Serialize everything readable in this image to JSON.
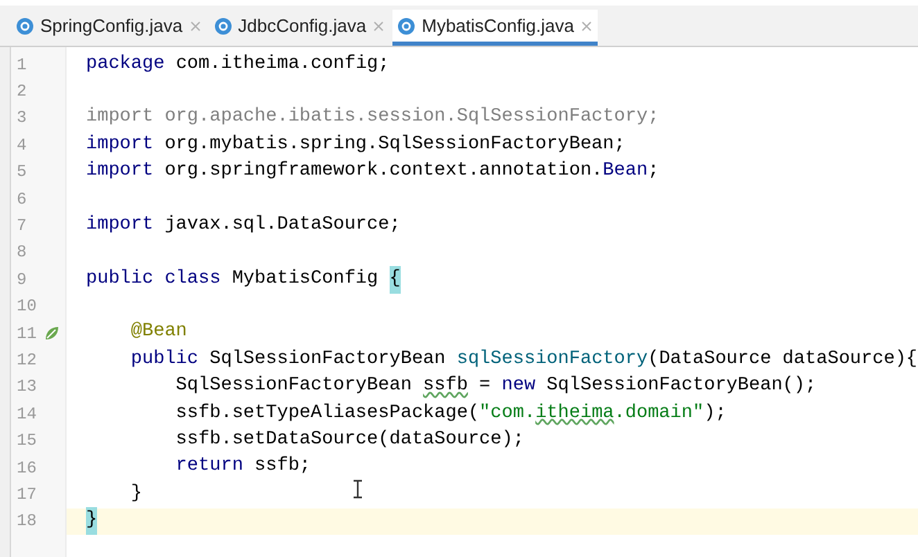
{
  "tabs": [
    {
      "label": "SpringConfig.java",
      "selected": false
    },
    {
      "label": "JdbcConfig.java",
      "selected": false
    },
    {
      "label": "MybatisConfig.java",
      "selected": true
    }
  ],
  "editor": {
    "lines": [
      {
        "number": "1",
        "current": false,
        "tokens": [
          {
            "text": "package",
            "kind": "keyword"
          },
          {
            "text": " com.itheima.config;",
            "kind": "plain"
          }
        ]
      },
      {
        "number": "2",
        "current": false
      },
      {
        "number": "3",
        "current": false,
        "tokens": [
          {
            "text": "import org.apache.ibatis.session.SqlSessionFactory;",
            "kind": "unused"
          }
        ]
      },
      {
        "number": "4",
        "current": false,
        "tokens": [
          {
            "text": "import",
            "kind": "keyword"
          },
          {
            "text": " org.mybatis.spring.SqlSessionFactoryBean;",
            "kind": "plain"
          }
        ]
      },
      {
        "number": "5",
        "current": false,
        "tokens": [
          {
            "text": "import",
            "kind": "keyword"
          },
          {
            "text": " org.springframework.context.annotation.",
            "kind": "plain"
          },
          {
            "text": "Bean",
            "kind": "keyword"
          },
          {
            "text": ";",
            "kind": "plain"
          }
        ]
      },
      {
        "number": "6",
        "current": false
      },
      {
        "number": "7",
        "current": false,
        "tokens": [
          {
            "text": "import",
            "kind": "keyword"
          },
          {
            "text": " javax.sql.DataSource;",
            "kind": "plain"
          }
        ]
      },
      {
        "number": "8",
        "current": false
      },
      {
        "number": "9",
        "current": false,
        "tokens": [
          {
            "text": "public class",
            "kind": "keyword"
          },
          {
            "text": " MybatisConfig ",
            "kind": "plain"
          },
          {
            "text": "{",
            "kind": "brace-match"
          }
        ]
      },
      {
        "number": "10",
        "current": false
      },
      {
        "number": "11",
        "current": false,
        "kind": "bean",
        "tokens": [
          {
            "text": "    @Bean",
            "kind": "annotation"
          }
        ]
      },
      {
        "number": "12",
        "current": false,
        "tokens": [
          {
            "text": "    public",
            "kind": "keyword"
          },
          {
            "text": " SqlSessionFactoryBean ",
            "kind": "plain"
          },
          {
            "text": "sqlSessionFactory",
            "kind": "method"
          },
          {
            "text": "(DataSource dataSource){",
            "kind": "plain"
          }
        ]
      },
      {
        "number": "13",
        "current": false,
        "tokens": [
          {
            "text": "        SqlSessionFactoryBean ",
            "kind": "plain"
          },
          {
            "text": "ssfb",
            "kind": "typo"
          },
          {
            "text": " = ",
            "kind": "plain"
          },
          {
            "text": "new",
            "kind": "keyword"
          },
          {
            "text": " SqlSessionFactoryBean();",
            "kind": "plain"
          }
        ]
      },
      {
        "number": "14",
        "current": false,
        "tokens": [
          {
            "text": "        ssfb.setTypeAliasesPackage(",
            "kind": "plain"
          },
          {
            "text": "\"com.",
            "kind": "string"
          },
          {
            "text": "itheima",
            "kind": "string-typo"
          },
          {
            "text": ".domain\"",
            "kind": "string"
          },
          {
            "text": ");",
            "kind": "plain"
          }
        ]
      },
      {
        "number": "15",
        "current": false,
        "tokens": [
          {
            "text": "        ssfb.setDataSource(dataSource);",
            "kind": "plain"
          }
        ]
      },
      {
        "number": "16",
        "current": false,
        "tokens": [
          {
            "text": "        return",
            "kind": "keyword"
          },
          {
            "text": " ssfb;",
            "kind": "plain"
          }
        ]
      },
      {
        "number": "17",
        "current": false,
        "tokens": [
          {
            "text": "    }",
            "kind": "plain"
          }
        ]
      },
      {
        "number": "18",
        "current": true,
        "tokens": [
          {
            "text": "}",
            "kind": "brace-match"
          }
        ]
      }
    ]
  }
}
